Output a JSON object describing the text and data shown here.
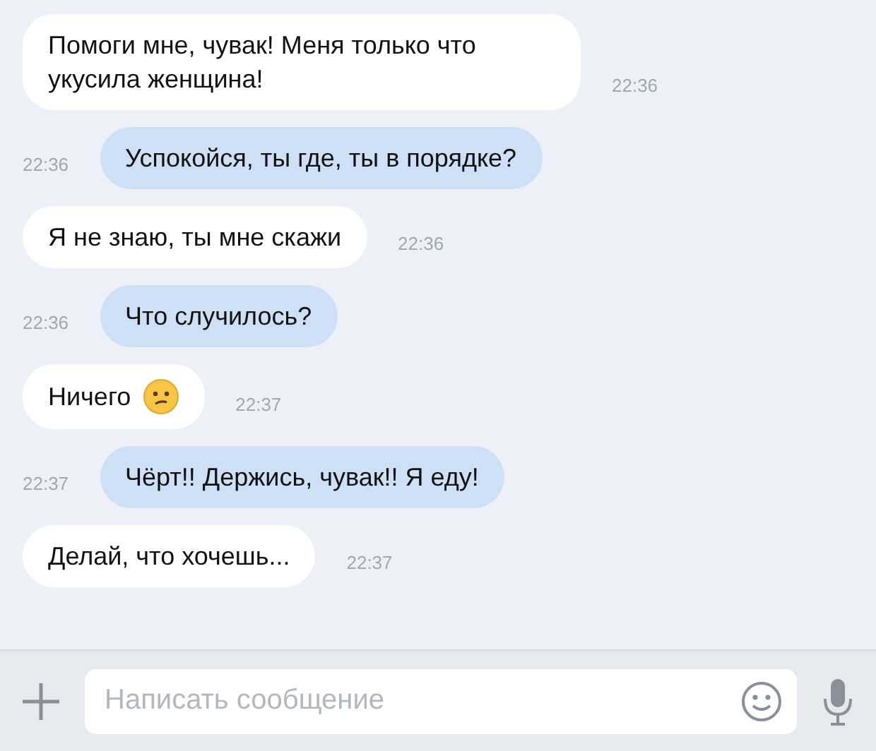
{
  "messages": [
    {
      "kind": "incoming",
      "text": "Помоги мне, чувак! Меня только что укусила женщина!",
      "time": "22:36",
      "emoji": false
    },
    {
      "kind": "outgoing",
      "text": "Успокойся, ты где, ты в порядке?",
      "time": "22:36",
      "emoji": false
    },
    {
      "kind": "incoming",
      "text": "Я не знаю, ты мне скажи",
      "time": "22:36",
      "emoji": false
    },
    {
      "kind": "outgoing",
      "text": "Что случилось?",
      "time": "22:36",
      "emoji": false
    },
    {
      "kind": "incoming",
      "text": "Ничего",
      "time": "22:37",
      "emoji": true
    },
    {
      "kind": "outgoing",
      "text": "Чёрт!! Держись, чувак!! Я еду!",
      "time": "22:37",
      "emoji": false
    },
    {
      "kind": "incoming",
      "text": "Делай, что хочешь...",
      "time": "22:37",
      "emoji": false
    }
  ],
  "composer": {
    "placeholder": "Написать сообщение"
  }
}
